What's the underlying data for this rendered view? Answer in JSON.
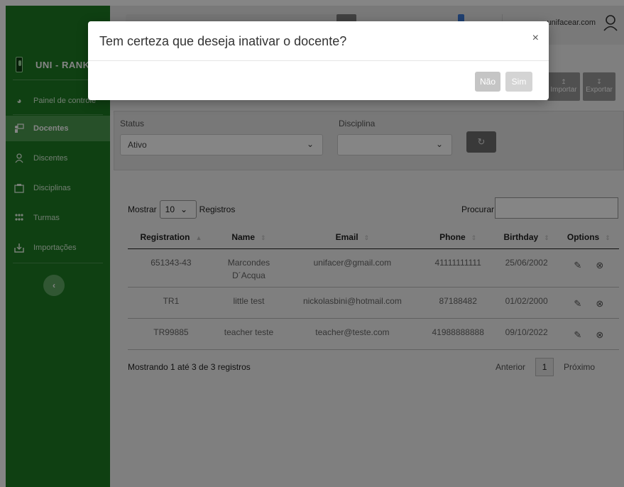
{
  "sidebar": {
    "brand": "UNI - RANK",
    "items": [
      {
        "label": "Painel de controle",
        "icon": "dashboard-icon"
      },
      {
        "label": "Docentes",
        "icon": "teacher-icon"
      },
      {
        "label": "Discentes",
        "icon": "student-icon"
      },
      {
        "label": "Disciplinas",
        "icon": "subjects-icon"
      },
      {
        "label": "Turmas",
        "icon": "classes-icon"
      },
      {
        "label": "Importações",
        "icon": "import-icon"
      }
    ],
    "collapse_label": "‹"
  },
  "topbar": {
    "user_email": "unifacear.com"
  },
  "actions": {
    "import_label": "Importar",
    "export_label": "Exportar"
  },
  "filters": {
    "status_label": "Status",
    "status_value": "Ativo",
    "discipline_label": "Disciplina",
    "discipline_value": ""
  },
  "table": {
    "show_prefix": "Mostrar",
    "page_length": "10",
    "show_suffix": "Registros",
    "search_label": "Procurar",
    "columns": [
      "Registration",
      "Name",
      "Email",
      "Phone",
      "Birthday",
      "Options"
    ],
    "rows": [
      {
        "registration": "651343-43",
        "name_line1": "Marcondes",
        "name_line2": "D´Acqua",
        "email": "unifacer@gmail.com",
        "phone": "41111111111",
        "birthday": "25/06/2002"
      },
      {
        "registration": "TR1",
        "name_line1": "little test",
        "name_line2": "",
        "email": "nickolasbini@hotmail.com",
        "phone": "87188482",
        "birthday": "01/02/2000"
      },
      {
        "registration": "TR99885",
        "name_line1": "teacher teste",
        "name_line2": "",
        "email": "teacher@teste.com",
        "phone": "41988888888",
        "birthday": "09/10/2022"
      }
    ],
    "info": "Mostrando 1 até 3 de 3 registros",
    "prev_label": "Anterior",
    "current_page": "1",
    "next_label": "Próximo"
  },
  "modal": {
    "title": "Tem certeza que deseja inativar o docente?",
    "close_label": "×",
    "no_label": "Não",
    "yes_label": "Sim"
  },
  "colors": {
    "sidebar_bg": "#1e7c24",
    "sidebar_active": "#4c9a50",
    "backdrop": "rgba(0,0,0,0.48)"
  }
}
